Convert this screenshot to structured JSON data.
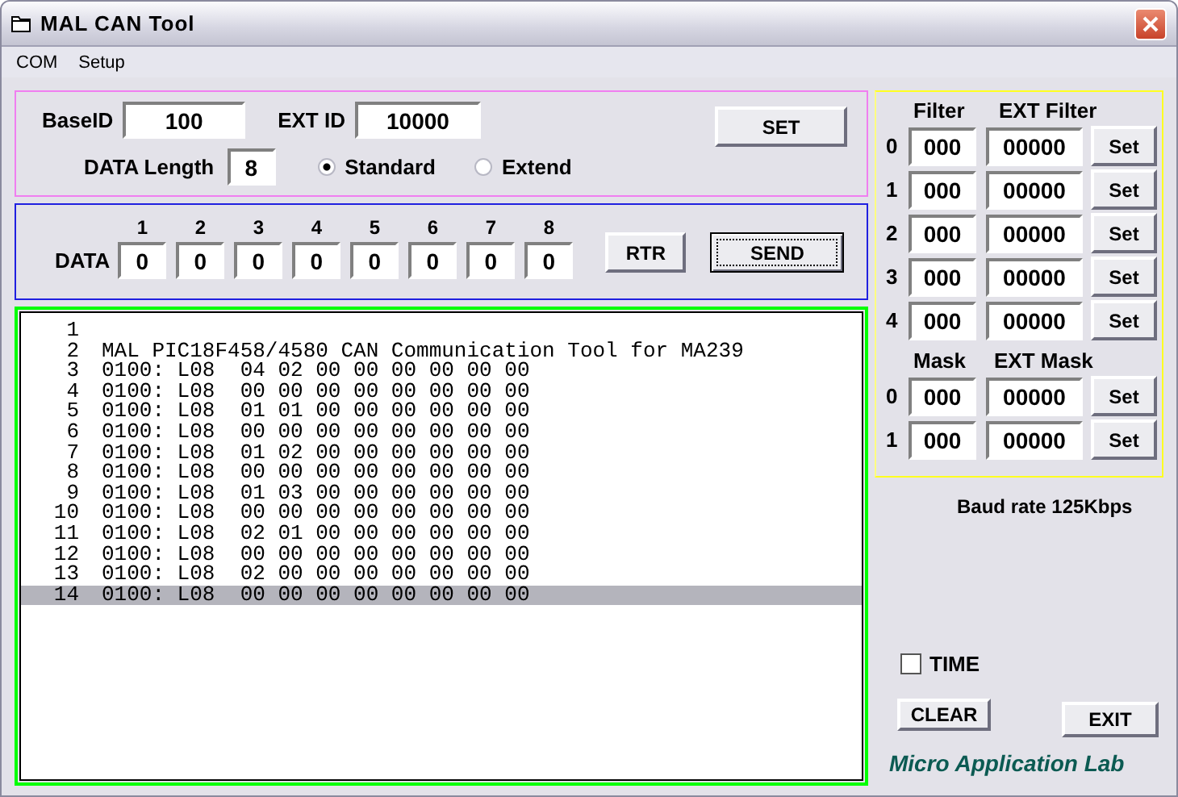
{
  "window": {
    "title": "MAL CAN Tool"
  },
  "menu": [
    {
      "label": "COM"
    },
    {
      "label": "Setup"
    }
  ],
  "id_panel": {
    "base_id": {
      "label": "BaseID",
      "value": "100"
    },
    "ext_id": {
      "label": "EXT ID",
      "value": "10000"
    },
    "data_length": {
      "label": "DATA Length",
      "value": "8"
    },
    "frame_types": [
      {
        "label": "Standard",
        "selected": true
      },
      {
        "label": "Extend",
        "selected": false
      }
    ],
    "set_button": "SET"
  },
  "data_panel": {
    "label": "DATA",
    "bytes": [
      {
        "index": "1",
        "value": "0"
      },
      {
        "index": "2",
        "value": "0"
      },
      {
        "index": "3",
        "value": "0"
      },
      {
        "index": "4",
        "value": "0"
      },
      {
        "index": "5",
        "value": "0"
      },
      {
        "index": "6",
        "value": "0"
      },
      {
        "index": "7",
        "value": "0"
      },
      {
        "index": "8",
        "value": "0"
      }
    ],
    "rtr_button": "RTR",
    "send_button": {
      "label": "SEND",
      "focused": true
    }
  },
  "log": {
    "lines": [
      {
        "number": "1",
        "selected": false
      },
      {
        "number": "2",
        "text": "MAL PIC18F458/4580 CAN Communication Tool for MA239",
        "selected": false
      },
      {
        "number": "3",
        "text": "0100: L08  04 02 00 00 00 00 00 00",
        "selected": false
      },
      {
        "number": "4",
        "text": "0100: L08  00 00 00 00 00 00 00 00",
        "selected": false
      },
      {
        "number": "5",
        "text": "0100: L08  01 01 00 00 00 00 00 00",
        "selected": false
      },
      {
        "number": "6",
        "text": "0100: L08  00 00 00 00 00 00 00 00",
        "selected": false
      },
      {
        "number": "7",
        "text": "0100: L08  01 02 00 00 00 00 00 00",
        "selected": false
      },
      {
        "number": "8",
        "text": "0100: L08  00 00 00 00 00 00 00 00",
        "selected": false
      },
      {
        "number": "9",
        "text": "0100: L08  01 03 00 00 00 00 00 00",
        "selected": false
      },
      {
        "number": "10",
        "text": "0100: L08  00 00 00 00 00 00 00 00",
        "selected": false
      },
      {
        "number": "11",
        "text": "0100: L08  02 01 00 00 00 00 00 00",
        "selected": false
      },
      {
        "number": "12",
        "text": "0100: L08  00 00 00 00 00 00 00 00",
        "selected": false
      },
      {
        "number": "13",
        "text": "0100: L08  02 00 00 00 00 00 00 00",
        "selected": false
      },
      {
        "number": "14",
        "text": "0100: L08  00 00 00 00 00 00 00 00",
        "selected": true
      }
    ]
  },
  "filter_panel": {
    "filter_header": "Filter",
    "ext_filter_header": "EXT Filter",
    "filters": [
      {
        "index": "0",
        "filter": "000",
        "ext_filter": "00000",
        "button": "Set"
      },
      {
        "index": "1",
        "filter": "000",
        "ext_filter": "00000",
        "button": "Set"
      },
      {
        "index": "2",
        "filter": "000",
        "ext_filter": "00000",
        "button": "Set"
      },
      {
        "index": "3",
        "filter": "000",
        "ext_filter": "00000",
        "button": "Set"
      },
      {
        "index": "4",
        "filter": "000",
        "ext_filter": "00000",
        "button": "Set"
      }
    ],
    "mask_header": "Mask",
    "ext_mask_header": "EXT Mask",
    "masks": [
      {
        "index": "0",
        "mask": "000",
        "ext_mask": "00000",
        "button": "Set"
      },
      {
        "index": "1",
        "mask": "000",
        "ext_mask": "00000",
        "button": "Set"
      }
    ]
  },
  "baud_rate": "Baud rate 125Kbps",
  "time_checkbox": {
    "label": "TIME",
    "checked": false
  },
  "clear_button": "CLEAR",
  "exit_button": "EXIT",
  "logo": "Micro Application Lab"
}
